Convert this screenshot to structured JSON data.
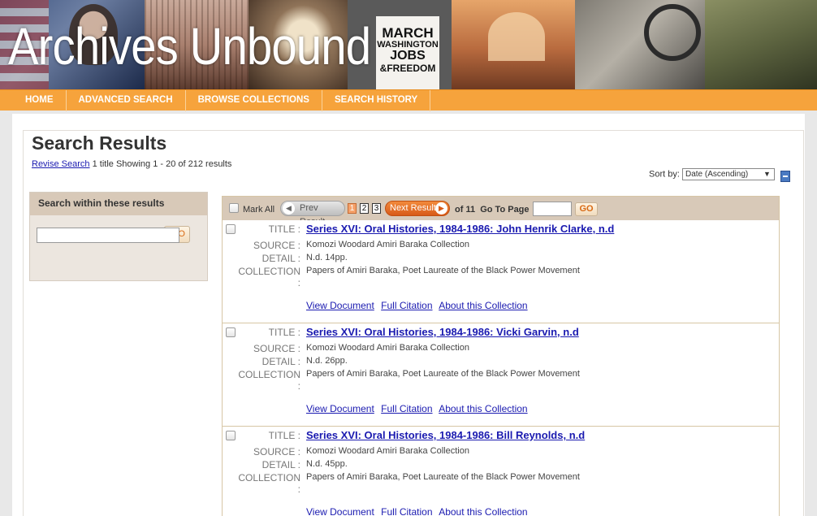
{
  "brand": "Archives Unbound",
  "banner": {
    "sign_line1": "MARCH",
    "sign_line2": "WASHINGTON",
    "sign_line3": "JOBS",
    "sign_line4": "&FREEDOM"
  },
  "nav": {
    "items": [
      "HOME",
      "ADVANCED SEARCH",
      "BROWSE COLLECTIONS",
      "SEARCH HISTORY"
    ]
  },
  "page_title": "Search Results",
  "summary": {
    "revise_label": "Revise Search",
    "text": "1 title Showing 1 - 20 of 212 results"
  },
  "sort": {
    "label": "Sort by:",
    "selected": "Date (Ascending)"
  },
  "filter": {
    "heading": "Search within these results",
    "input_value": "",
    "go_label": "GO"
  },
  "pager": {
    "mark_all": "Mark All",
    "prev_label": "Prev Result",
    "next_label": "Next Result",
    "pages": [
      "1",
      "2",
      "3"
    ],
    "current_page": "1",
    "of_label": "of",
    "total_pages": "11",
    "goto_label": "Go To Page",
    "goto_value": "",
    "go_label": "GO"
  },
  "labels": {
    "title": "TITLE :",
    "source": "SOURCE :",
    "detail": "DETAIL :",
    "collection": "COLLECTION",
    "colon": ":"
  },
  "actions": {
    "view": "View Document",
    "citation": "Full Citation",
    "about": "About this Collection"
  },
  "records": [
    {
      "title": "Series XVI: Oral Histories, 1984-1986: John Henrik Clarke, n.d",
      "source": "Komozi Woodard Amiri Baraka Collection",
      "detail": "N.d. 14pp.",
      "collection": "Papers of Amiri Baraka, Poet Laureate of the Black Power Movement"
    },
    {
      "title": "Series XVI: Oral Histories, 1984-1986: Vicki Garvin, n.d",
      "source": "Komozi Woodard Amiri Baraka Collection",
      "detail": "N.d. 26pp.",
      "collection": "Papers of Amiri Baraka, Poet Laureate of the Black Power Movement"
    },
    {
      "title": "Series XVI: Oral Histories, 1984-1986: Bill Reynolds, n.d",
      "source": "Komozi Woodard Amiri Baraka Collection",
      "detail": "N.d. 45pp.",
      "collection": "Papers of Amiri Baraka, Poet Laureate of the Black Power Movement"
    }
  ]
}
